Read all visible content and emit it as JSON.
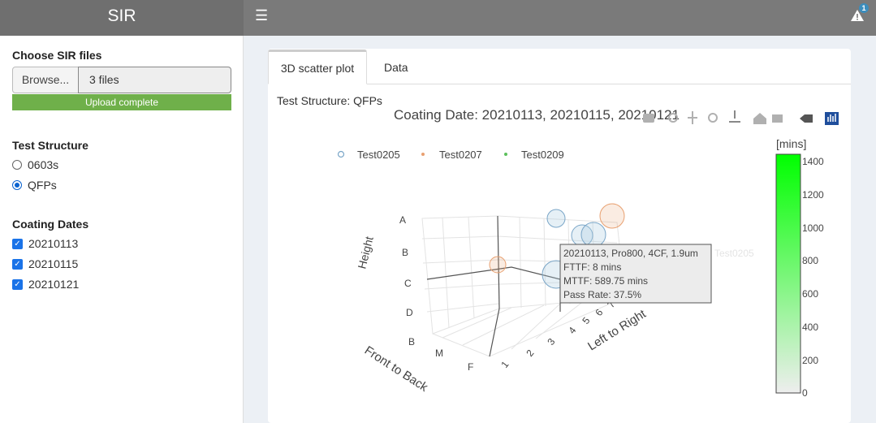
{
  "app": {
    "title": "SIR",
    "alert_count": "1"
  },
  "sidebar": {
    "files_label": "Choose SIR files",
    "browse_label": "Browse...",
    "files_value": "3 files",
    "upload_status": "Upload complete",
    "structure_label": "Test Structure",
    "structures": [
      {
        "label": "0603s",
        "selected": false
      },
      {
        "label": "QFPs",
        "selected": true
      }
    ],
    "dates_label": "Coating Dates",
    "dates": [
      {
        "label": "20210113",
        "checked": true
      },
      {
        "label": "20210115",
        "checked": true
      },
      {
        "label": "20210121",
        "checked": true
      }
    ]
  },
  "tabs": [
    {
      "label": "3D scatter plot",
      "active": true
    },
    {
      "label": "Data",
      "active": false
    }
  ],
  "plot": {
    "caption": "Test Structure: QFPs",
    "title": "Coating Date: 20210113, 20210115, 20210121",
    "legend": [
      {
        "name": "Test0205",
        "color": "#7aa6c8"
      },
      {
        "name": "Test0207",
        "color": "#e8a070"
      },
      {
        "name": "Test0209",
        "color": "#5cc05c"
      }
    ],
    "axes": {
      "height_title": "Height",
      "height_ticks": [
        "A",
        "B",
        "C",
        "D"
      ],
      "front_title": "Front to Back",
      "front_ticks": [
        "B",
        "M",
        "F"
      ],
      "left_title": "Left to Right",
      "left_ticks": [
        "1",
        "2",
        "3",
        "4",
        "5",
        "6",
        "7",
        "8"
      ]
    },
    "colorbar": {
      "title": "[mins]",
      "ticks": [
        "1400",
        "1200",
        "1000",
        "800",
        "600",
        "400",
        "200",
        "0"
      ]
    },
    "tooltip": {
      "line1": "20210113, Pro800, 4CF, 1.9um",
      "line2": "FTTF: 8 mins",
      "line3": "MTTF: 589.75 mins",
      "line4": "Pass Rate: 37.5%",
      "series": "Test0205"
    }
  },
  "colors": {
    "navbar": "#7a7a7a",
    "logo_bg": "#6f6f6f",
    "progress": "#6fb04a",
    "accent": "#1a73e8"
  }
}
